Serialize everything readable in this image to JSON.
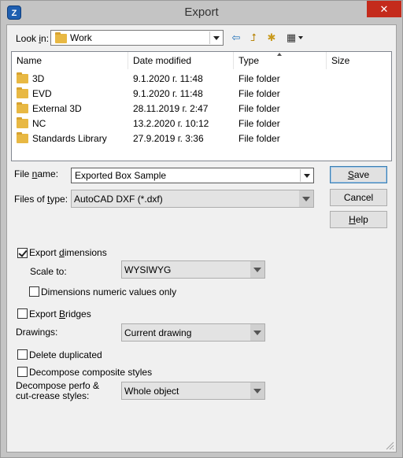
{
  "window": {
    "title": "Export",
    "app_icon": "Z",
    "close_glyph": "✕"
  },
  "lookin": {
    "label_pre": "Look ",
    "label_u": "i",
    "label_post": "n:",
    "value": "Work"
  },
  "toolbar": {
    "back_glyph": "⇦",
    "up_glyph": "⮥",
    "newfolder_glyph": "✱",
    "views_glyph": "▦"
  },
  "file_list": {
    "columns": [
      "Name",
      "Date modified",
      "Type",
      "Size"
    ],
    "rows": [
      {
        "name": "3D",
        "date": "9.1.2020 г. 11:48",
        "type": "File folder",
        "size": ""
      },
      {
        "name": "EVD",
        "date": "9.1.2020 г. 11:48",
        "type": "File folder",
        "size": ""
      },
      {
        "name": "External 3D",
        "date": "28.11.2019 г. 2:47",
        "type": "File folder",
        "size": ""
      },
      {
        "name": "NC",
        "date": "13.2.2020 г. 10:12",
        "type": "File folder",
        "size": ""
      },
      {
        "name": "Standards Library",
        "date": "27.9.2019 г. 3:36",
        "type": "File folder",
        "size": ""
      }
    ]
  },
  "filename": {
    "label_pre": "File ",
    "label_u": "n",
    "label_post": "ame:",
    "value": "Exported Box Sample"
  },
  "filetype": {
    "label_pre": "Files of ",
    "label_u": "t",
    "label_post": "ype:",
    "value": "AutoCAD DXF (*.dxf)"
  },
  "buttons": {
    "save_u": "S",
    "save_rest": "ave",
    "cancel": "Cancel",
    "help_u": "H",
    "help_rest": "elp"
  },
  "options": {
    "export_dimensions": {
      "pre": "Export ",
      "u": "d",
      "post": "imensions",
      "checked": true
    },
    "scale_to": {
      "label": "Scale to:",
      "value": "WYSIWYG"
    },
    "dim_numeric": {
      "label": "Dimensions numeric values only",
      "checked": false
    },
    "export_bridges": {
      "pre": "Export ",
      "u": "B",
      "post": "ridges",
      "checked": false
    },
    "drawings": {
      "label": "Drawings:",
      "value": "Current drawing"
    },
    "delete_duplicated": {
      "label": "Delete duplicated",
      "checked": false
    },
    "decompose_composite": {
      "label": "Decompose composite styles",
      "checked": false
    },
    "decompose_perfo": {
      "label_line1": "Decompose perfo &",
      "label_line2": "cut-crease styles:",
      "value": "Whole object"
    }
  }
}
